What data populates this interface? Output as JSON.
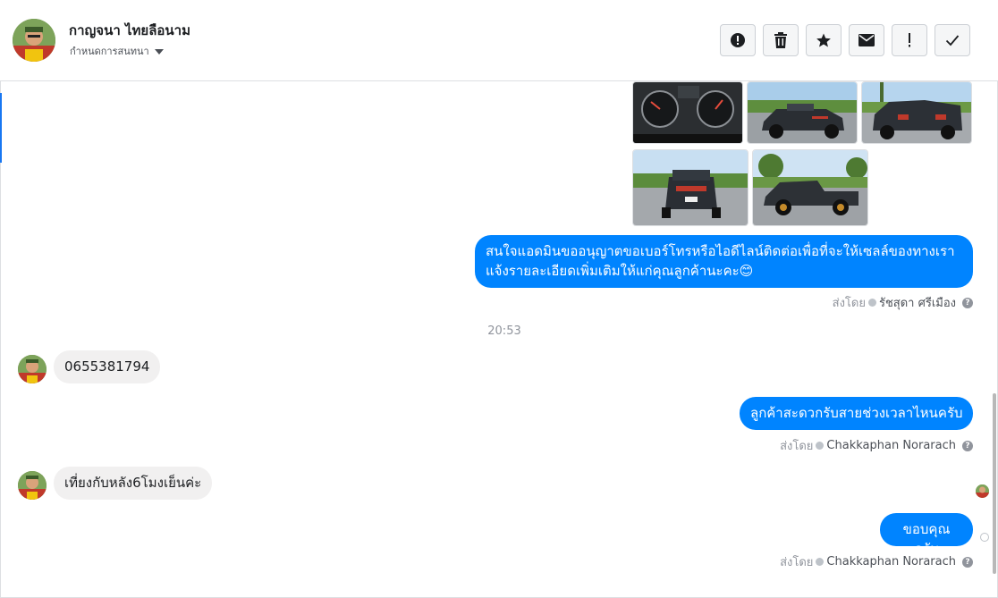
{
  "header": {
    "contact_name": "กาญจนา ไทยลือนาม",
    "assign_label": "กำหนดการสนทนา",
    "toolbar": [
      {
        "name": "spam-button",
        "icon": "alert-circle-icon"
      },
      {
        "name": "delete-button",
        "icon": "trash-icon"
      },
      {
        "name": "star-button",
        "icon": "star-icon"
      },
      {
        "name": "mark-unread-button",
        "icon": "envelope-icon"
      },
      {
        "name": "follow-up-button",
        "icon": "exclamation-icon"
      },
      {
        "name": "mark-done-button",
        "icon": "check-icon"
      }
    ]
  },
  "conversation": {
    "msg1": "สนใจแอดมินขออนุญาตขอเบอร์โทรหรือไอดีไลน์ติดต่อเพื่อที่จะให้เซลล์ของทางเรา",
    "msg1b": "แจ้งรายละเอียดเพิ่มเติมให้แก่คุณลูกค้านะคะ😊",
    "sent_by_label": "ส่งโดย",
    "msg1_agent": "รัชสุดา ศรีเมือง",
    "timestamp": "20:53",
    "msg2": "0655381794",
    "msg3": "ลูกค้าสะดวกรับสายช่วงเวลาไหนครับ",
    "msg3_agent": "Chakkaphan Norarach",
    "msg4": "เที่ยงกับหลัง6โมงเย็นค่ะ",
    "msg5": "ขอบคุณครับ",
    "msg5_agent": "Chakkaphan Norarach",
    "help_glyph": "?"
  },
  "colors": {
    "accent": "#1877f2",
    "outgoing_bubble": "#0084ff",
    "incoming_bubble": "#f1f0f0"
  }
}
